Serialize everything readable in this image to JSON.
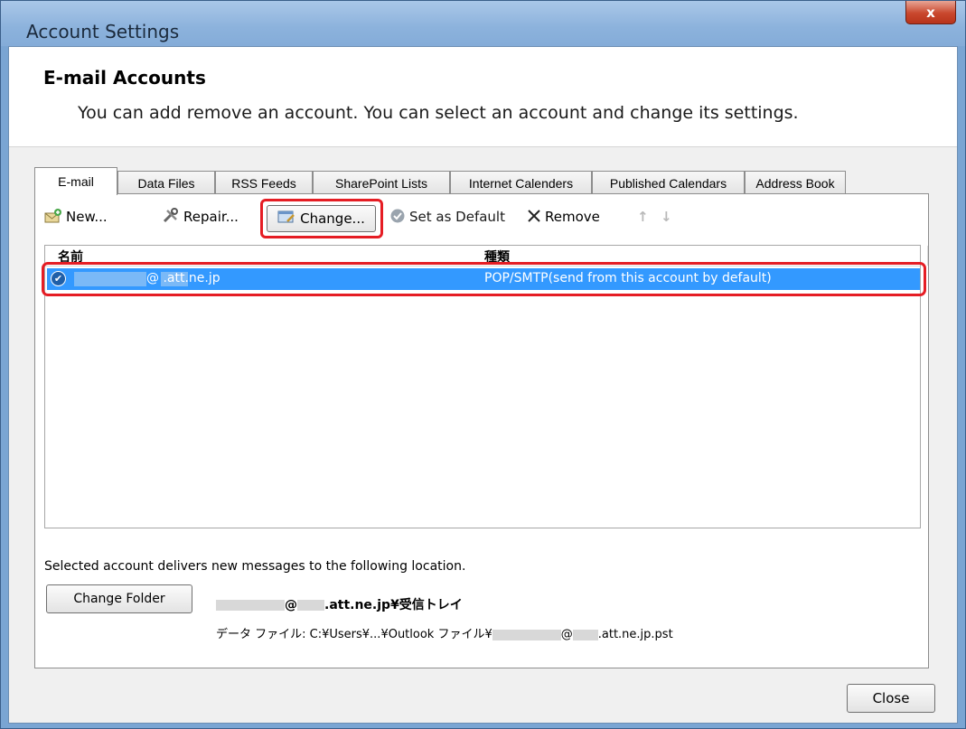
{
  "window": {
    "title": "Account Settings",
    "close_glyph": "x"
  },
  "header": {
    "title": "E-mail Accounts",
    "subtitle": "You can add remove an account. You can select an account and change its settings."
  },
  "tabs": [
    {
      "label": "E-mail",
      "active": true
    },
    {
      "label": "Data Files"
    },
    {
      "label": "RSS Feeds"
    },
    {
      "label": "SharePoint Lists"
    },
    {
      "label": "Internet Calenders"
    },
    {
      "label": "Published Calendars"
    },
    {
      "label": "Address Book"
    }
  ],
  "toolbar": {
    "new_label": "New...",
    "repair_label": "Repair...",
    "change_label": "Change...",
    "set_default_label": "Set as Default",
    "remove_label": "Remove",
    "move_up_glyph": "↑",
    "move_down_glyph": "↓"
  },
  "account_list": {
    "col_name": "名前",
    "col_type": "種類",
    "rows": [
      {
        "name": "@ .att.ne.jp",
        "type": "POP/SMTP(send from this account by default)",
        "selected": true
      }
    ]
  },
  "delivery": {
    "label": "Selected account delivers new messages to the following location.",
    "change_folder_label": "Change Folder",
    "folder_path_at": "@",
    "folder_path_rest": ".att.ne.jp¥受信トレイ",
    "data_file_prefix": "データ ファイル: C:¥Users¥...¥Outlook ファイル¥",
    "data_file_at": "@",
    "data_file_rest": ".att.ne.jp.pst"
  },
  "footer": {
    "close_label": "Close"
  },
  "colors": {
    "selection": "#3399ff",
    "highlight_outline": "#e51d24",
    "title_bar": "#8cb2dc"
  }
}
